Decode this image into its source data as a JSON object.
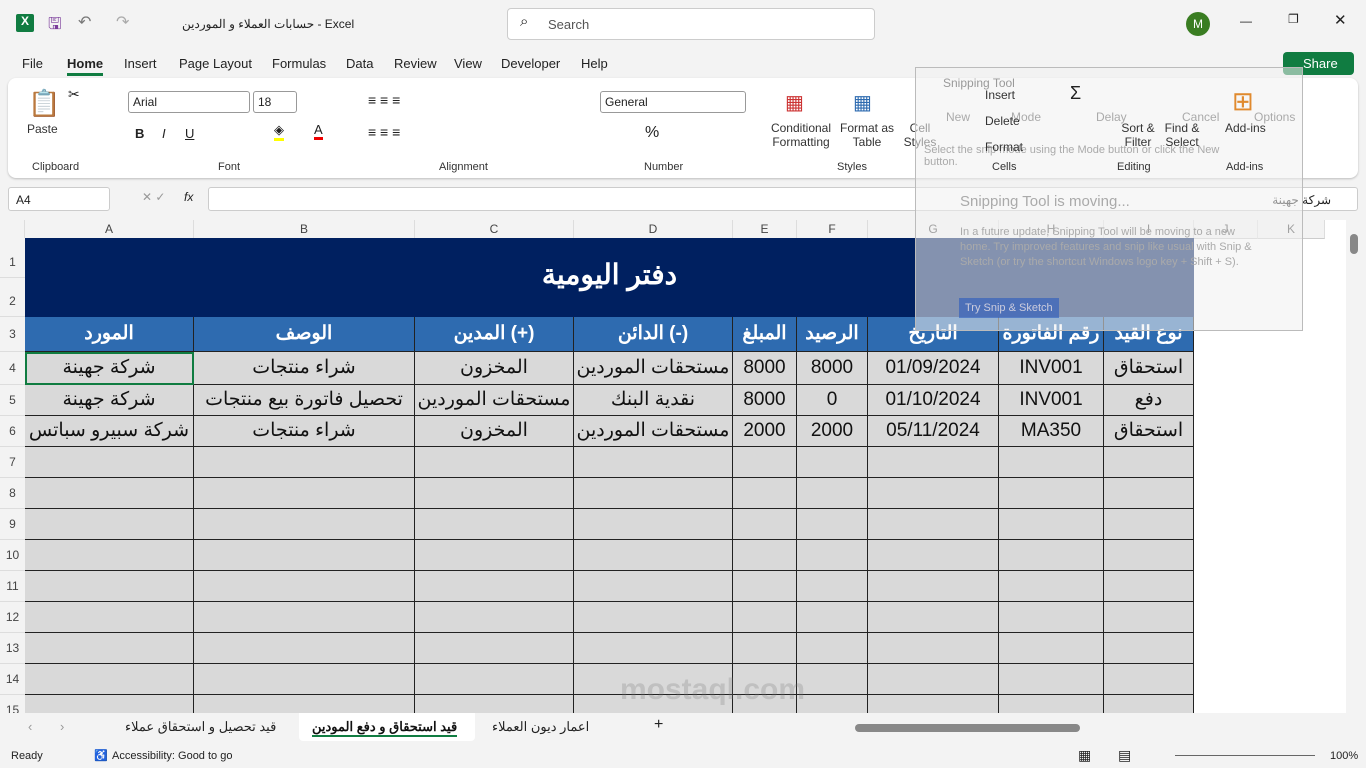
{
  "app": {
    "title": "حسابات العملاء و الموردين - Excel",
    "search_placeholder": "Search",
    "user_initial": "M",
    "share": "Share"
  },
  "menu": [
    "File",
    "Home",
    "Insert",
    "Page Layout",
    "Formulas",
    "Data",
    "Review",
    "View",
    "Developer",
    "Help"
  ],
  "ribbon": {
    "font": "Arial",
    "size": "18",
    "number_format": "General",
    "paste": "Paste",
    "groups": [
      "Clipboard",
      "Font",
      "Alignment",
      "Number",
      "Styles",
      "Cells",
      "Editing",
      "Add-ins"
    ],
    "styles": [
      "Conditional Formatting",
      "Format as Table",
      "Cell Styles"
    ],
    "cells": [
      "Insert",
      "Delete",
      "Format"
    ],
    "editing": [
      "Sort & Filter",
      "Find & Select"
    ],
    "addins": "Add-ins"
  },
  "formula_bar": {
    "name_box": "A4",
    "fx": "fx",
    "value": "شركة جهينة"
  },
  "columns": [
    "A",
    "B",
    "C",
    "D",
    "E",
    "F",
    "G",
    "H",
    "I",
    "J",
    "K"
  ],
  "rows": [
    "1",
    "2",
    "3",
    "4",
    "5",
    "6",
    "7",
    "8",
    "9",
    "10",
    "11",
    "12",
    "13",
    "14",
    "15"
  ],
  "sheet": {
    "title": "دفتر اليومية",
    "headers": [
      "المورد",
      "الوصف",
      "المدين (+)",
      "الدائن (-)",
      "المبلغ",
      "الرصيد",
      "التاريخ",
      "رقم الفاتورة",
      "نوع القيد"
    ],
    "data": [
      [
        "شركة جهينة",
        "شراء منتجات",
        "المخزون",
        "مستحقات الموردين",
        "8000",
        "8000",
        "01/09/2024",
        "INV001",
        "استحقاق"
      ],
      [
        "شركة جهينة",
        "تحصيل فاتورة بيع منتجات",
        "مستحقات الموردين",
        "نقدية البنك",
        "8000",
        "0",
        "01/10/2024",
        "INV001",
        "دفع"
      ],
      [
        "شركة سبيرو سباتس",
        "شراء منتجات",
        "المخزون",
        "مستحقات الموردين",
        "2000",
        "2000",
        "05/11/2024",
        "MA350",
        "استحقاق"
      ]
    ]
  },
  "tabs": [
    {
      "label": "قيد تحصيل و استحقاق عملاء",
      "active": false
    },
    {
      "label": "قيد استحقاق و دفع المودين",
      "active": true
    },
    {
      "label": "اعمار ديون العملاء",
      "active": false
    }
  ],
  "status": {
    "ready": "Ready",
    "accessibility": "Accessibility: Good to go",
    "zoom": "100%"
  },
  "snipping": {
    "title": "Snipping Tool",
    "new": "New",
    "mode": "Mode",
    "delay": "Delay",
    "cancel": "Cancel",
    "options": "Options",
    "hint": "Select the snip mode using the Mode button or click the New button.",
    "heading": "Snipping Tool is moving...",
    "body": "In a future update, Snipping Tool will be moving to a new home. Try improved features and snip like usual with Snip & Sketch (or try the shortcut Windows logo key + Shift + S).",
    "try": "Try Snip & Sketch"
  },
  "watermark": "mostaql.com",
  "colors": {
    "title_bg": "#002060",
    "header_bg": "#2e6bb0",
    "cell_bg": "#d9d9d9",
    "excel_green": "#107c41"
  }
}
